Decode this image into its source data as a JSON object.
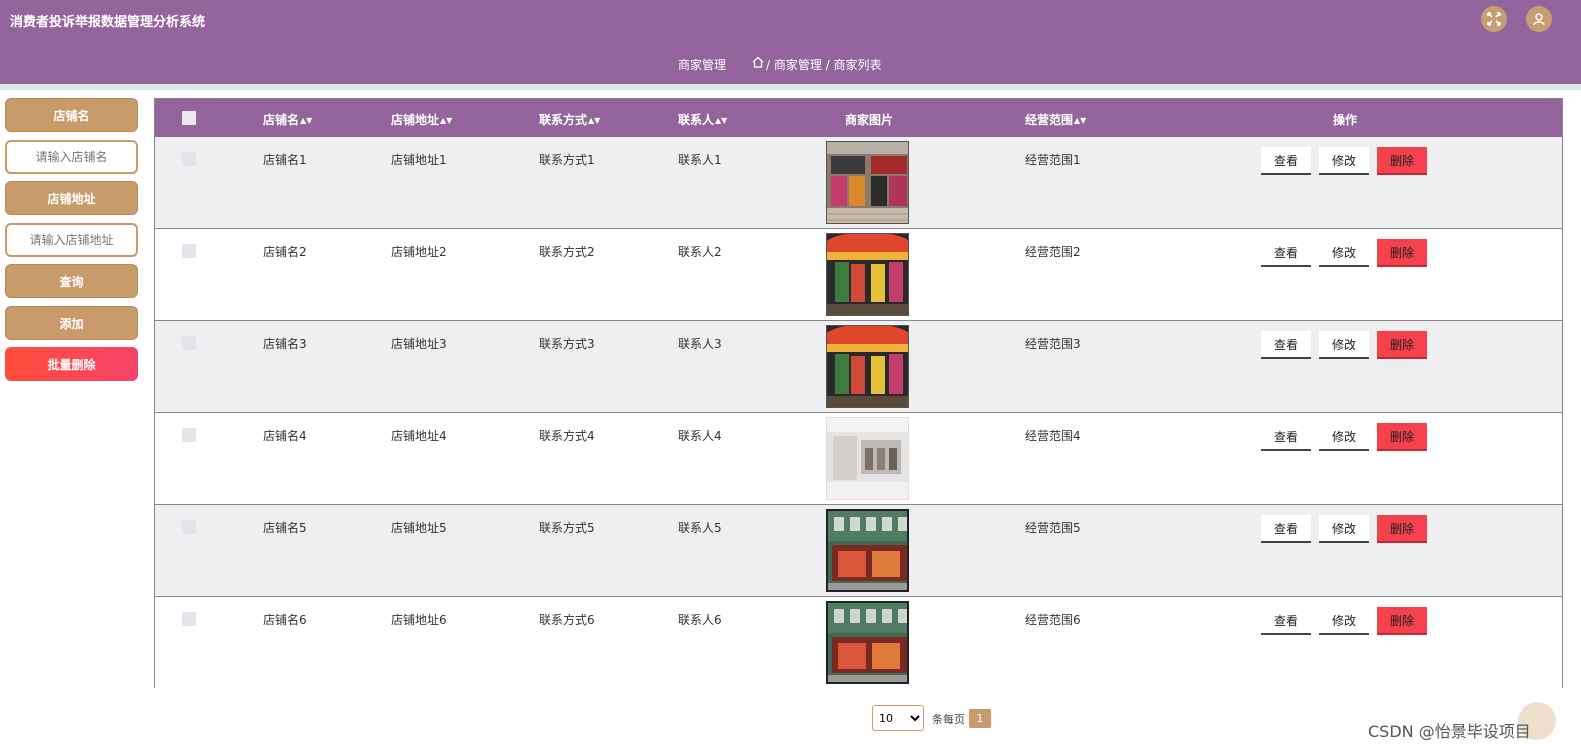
{
  "app": {
    "title": "消费者投诉举报数据管理分析系统"
  },
  "header": {
    "icons": {
      "fullscreen": "fullscreen-icon",
      "user": "user-icon"
    },
    "breadcrumb": {
      "module": "商家管理",
      "path": "/ 商家管理 / 商家列表"
    }
  },
  "sidebar": {
    "store_name_label": "店铺名",
    "store_name_placeholder": "请输入店铺名",
    "store_address_label": "店铺地址",
    "store_address_placeholder": "请输入店铺地址",
    "query_button": "查询",
    "add_button": "添加",
    "batch_delete_button": "批量删除"
  },
  "table": {
    "columns": [
      "店铺名",
      "店铺地址",
      "联系方式",
      "联系人",
      "商家图片",
      "经营范围",
      "操作"
    ],
    "sort_icon": "▲▼",
    "rows": [
      {
        "name": "店铺名1",
        "address": "店铺地址1",
        "contact": "联系方式1",
        "person": "联系人1",
        "scope": "经营范围1",
        "image": "storefront-photo-1"
      },
      {
        "name": "店铺名2",
        "address": "店铺地址2",
        "contact": "联系方式2",
        "person": "联系人2",
        "scope": "经营范围2",
        "image": "storefront-photo-2"
      },
      {
        "name": "店铺名3",
        "address": "店铺地址3",
        "contact": "联系方式3",
        "person": "联系人3",
        "scope": "经营范围3",
        "image": "storefront-photo-2"
      },
      {
        "name": "店铺名4",
        "address": "店铺地址4",
        "contact": "联系方式4",
        "person": "联系人4",
        "scope": "经营范围4",
        "image": "storefront-photo-3"
      },
      {
        "name": "店铺名5",
        "address": "店铺地址5",
        "contact": "联系方式5",
        "person": "联系人5",
        "scope": "经营范围5",
        "image": "storefront-photo-4"
      },
      {
        "name": "店铺名6",
        "address": "店铺地址6",
        "contact": "联系方式6",
        "person": "联系人6",
        "scope": "经营范围6",
        "image": "storefront-photo-4"
      }
    ],
    "actions": {
      "view": "查看",
      "edit": "修改",
      "delete": "删除"
    }
  },
  "pagination": {
    "page_size": "10",
    "page_size_options": [
      "10"
    ],
    "per_page_label": "条每页",
    "current_page": "1"
  },
  "watermark": "CSDN @怡景毕设项目",
  "colors": {
    "header": "#94659d",
    "accent": "#c99b6a",
    "danger": "#f5414b"
  }
}
